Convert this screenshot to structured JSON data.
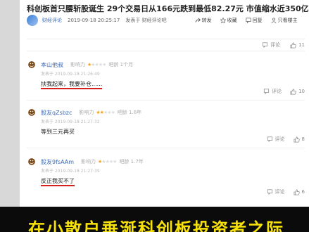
{
  "article": {
    "title": "科创板首只腰斩股诞生 29个交易日从166元跌到最低82.27元 市值缩水近350亿",
    "source": "财经评论",
    "time": "2019-09-18 20:25:17",
    "from": "发表于 财经评论吧",
    "share_label": "转发",
    "fav_label": "收藏",
    "reply_label": "回复",
    "owner_only_label": "只看楼主"
  },
  "topbar": {
    "comment_label": "评论",
    "like_count": "11"
  },
  "comments": [
    {
      "name": "本山他叔",
      "influence_label": "影响力",
      "stars": 1,
      "age": "吧龄 1个月",
      "time": "发表于 2019-09-18 21:26:49",
      "body": "扶我起来，我要补仓......",
      "comment_label": "评论",
      "like_count": "10"
    },
    {
      "name": "股友qZsbzc",
      "influence_label": "影响力",
      "stars": 2,
      "age": "吧龄 1.6年",
      "time": "发表于 2019-09-18 21:27:32",
      "body": "等到三元再买",
      "comment_label": "评论",
      "like_count": "8"
    },
    {
      "name": "股友9fsAAm",
      "influence_label": "影响力",
      "stars": 1,
      "age": "吧龄 1.7年",
      "time": "发表于 2019-09-18 21:27:39",
      "body": "反正我买不了",
      "comment_label": "评论",
      "like_count": "6"
    }
  ],
  "banner": {
    "text": "在小散户垂涎科创板投资者之际"
  },
  "colors": {
    "accent": "#3b69b5",
    "star": "#f3a21a",
    "banner_text": "#f6e10a",
    "underline": "#d62020"
  }
}
